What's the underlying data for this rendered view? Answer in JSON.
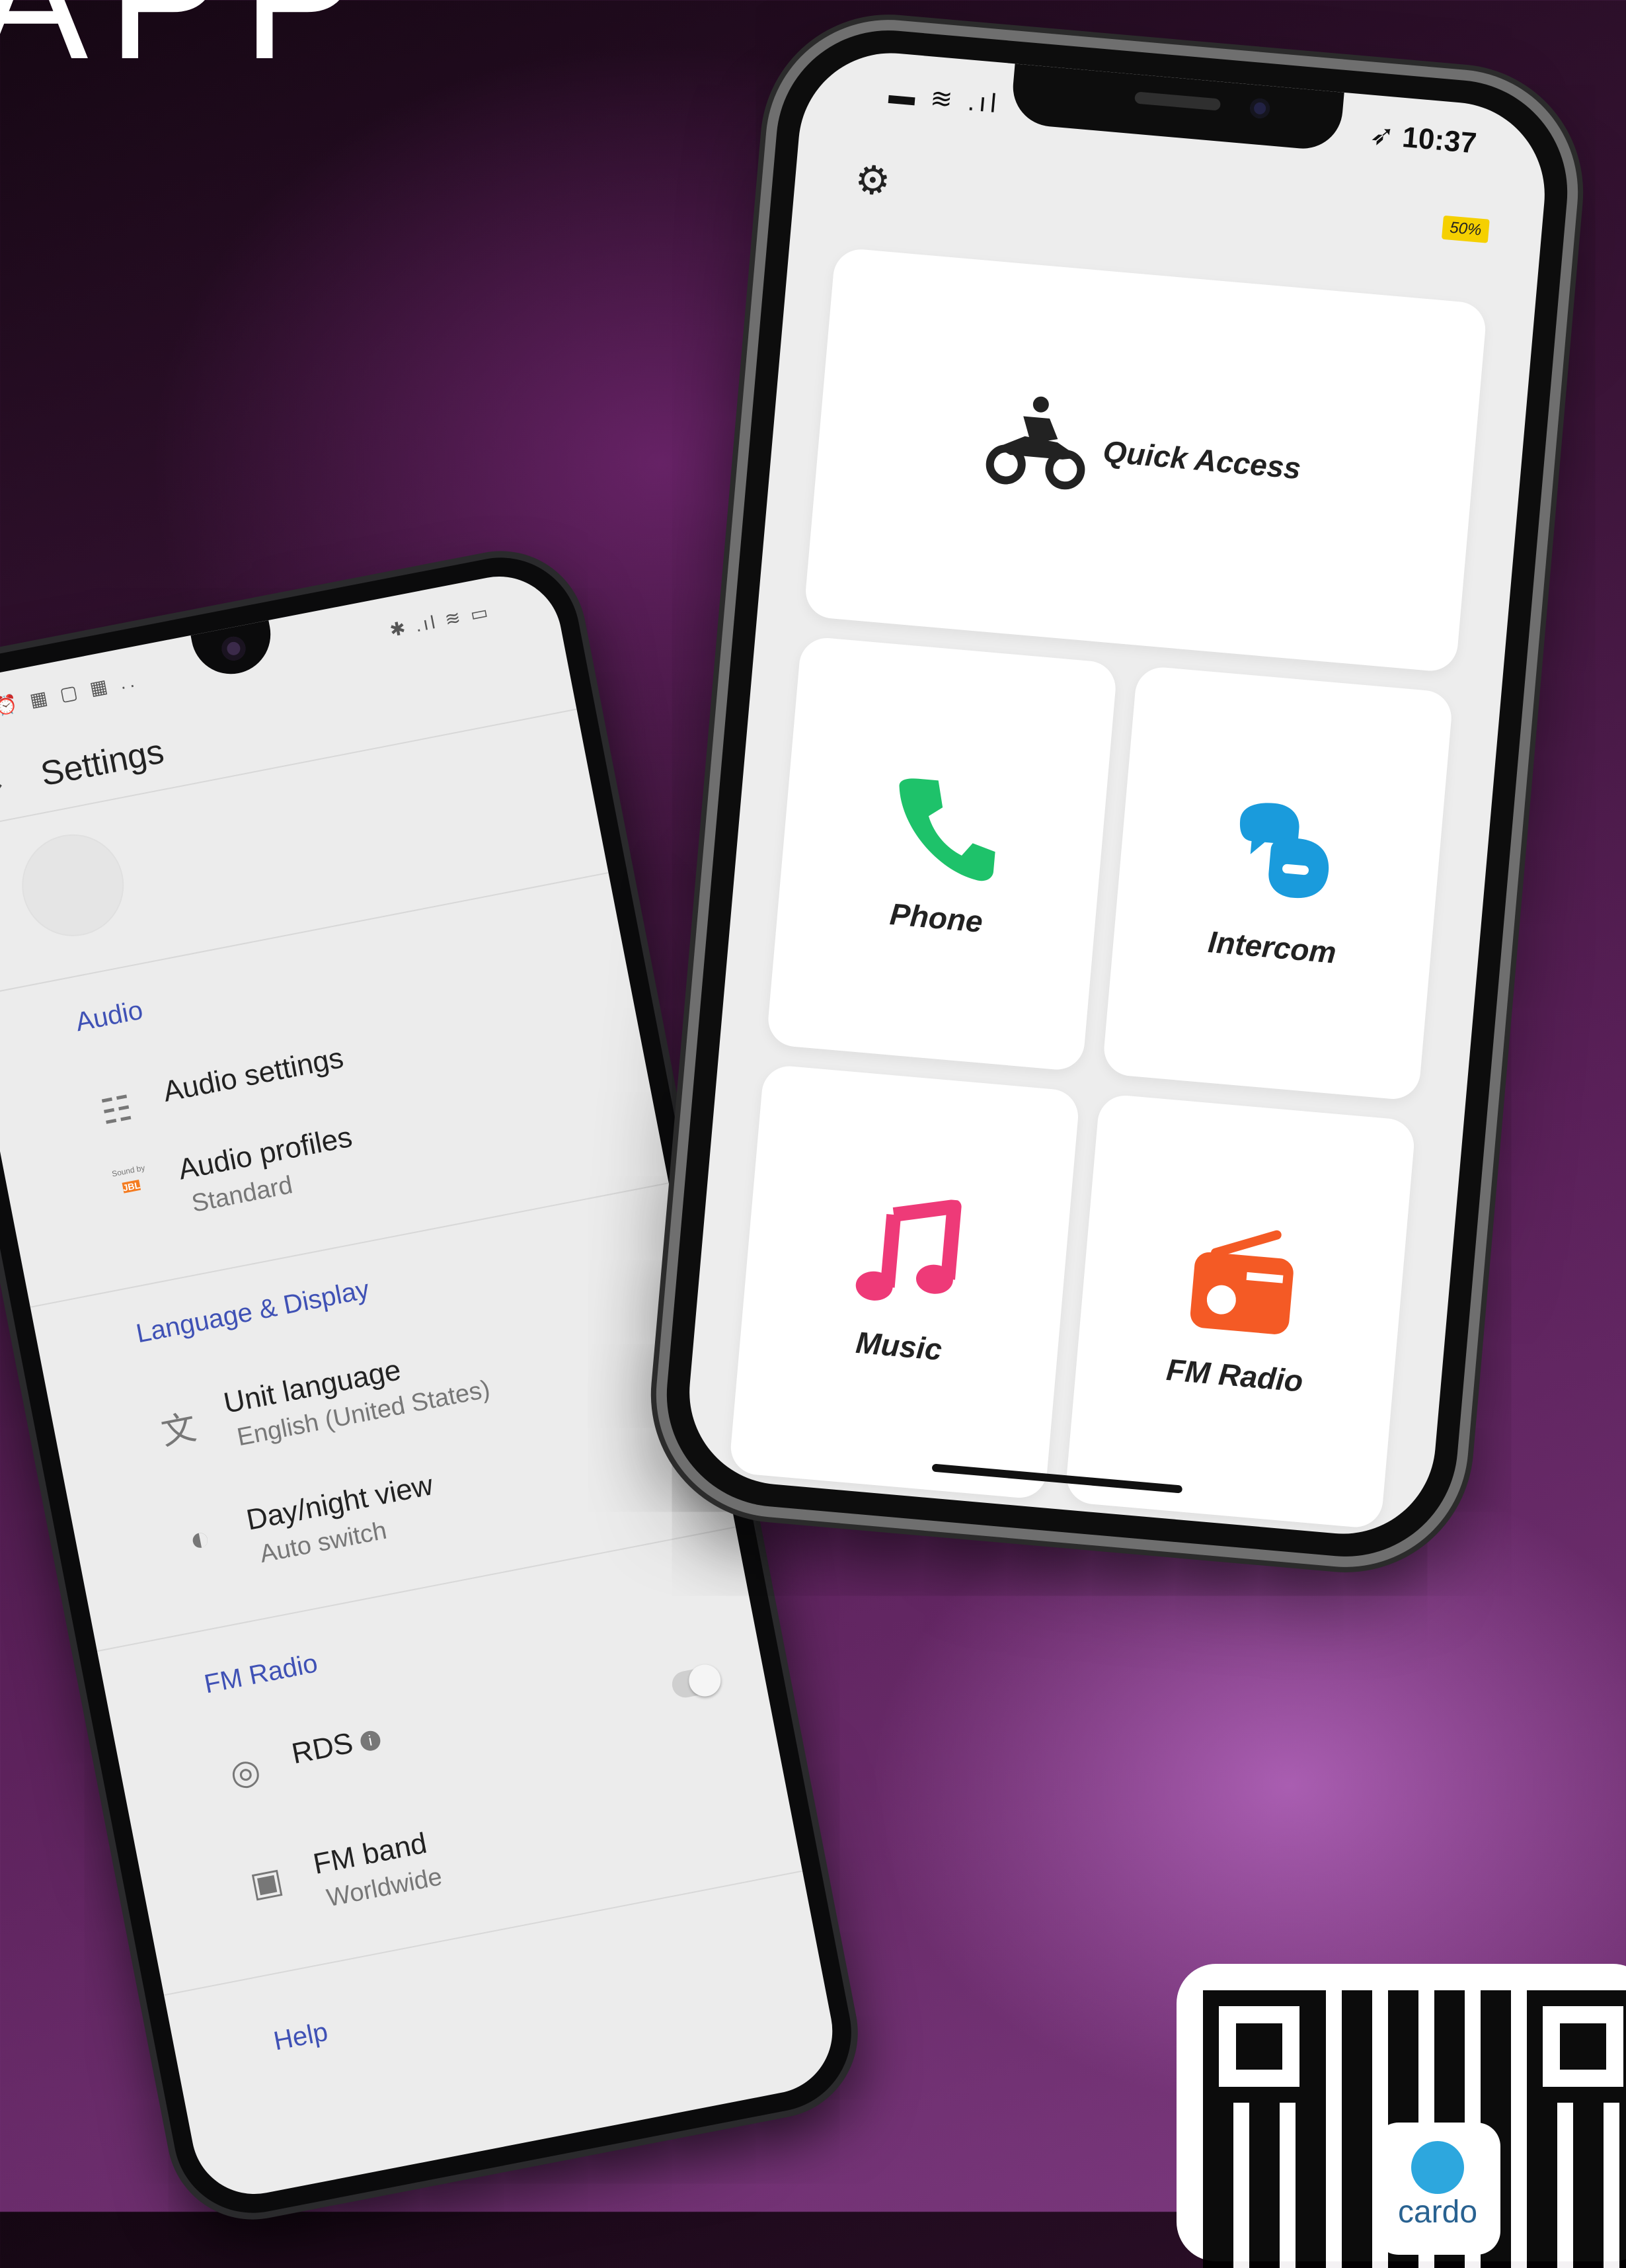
{
  "hero": {
    "title": "APP"
  },
  "android": {
    "status_left": "⏰ ▦ ▢ ▦ ..",
    "status_right": "✱ .ıl ≋ ▭",
    "title": "Settings",
    "sections": {
      "audio": {
        "header": "Audio",
        "audio_settings": "Audio settings",
        "audio_profiles": "Audio profiles",
        "audio_profiles_sub": "Standard",
        "sound_by": "Sound by",
        "jbl": "JBL"
      },
      "language": {
        "header": "Language & Display",
        "unit_language": "Unit language",
        "unit_language_sub": "English (United States)",
        "day_night": "Day/night view",
        "day_night_sub": "Auto switch"
      },
      "fm": {
        "header": "FM Radio",
        "rds": "RDS",
        "fm_band": "FM band",
        "fm_band_sub": "Worldwide"
      },
      "help": {
        "header": "Help"
      }
    }
  },
  "iphone": {
    "status_time": "10:37",
    "battery": "50%",
    "tiles": {
      "quick_access": "Quick Access",
      "phone": "Phone",
      "intercom": "Intercom",
      "music": "Music",
      "fm_radio": "FM Radio"
    },
    "colors": {
      "phone": "#1ec26a",
      "intercom": "#1a9bdc",
      "music": "#ee3a78",
      "fm_radio": "#f45a25",
      "battery": "#f5d000"
    }
  },
  "qr": {
    "logo_text": "cardo"
  }
}
